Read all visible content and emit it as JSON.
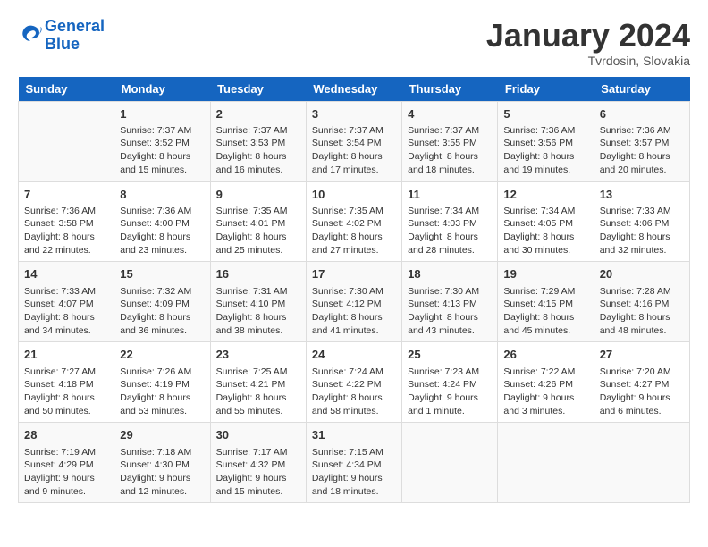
{
  "header": {
    "logo_line1": "General",
    "logo_line2": "Blue",
    "month_year": "January 2024",
    "location": "Tvrdosin, Slovakia"
  },
  "weekdays": [
    "Sunday",
    "Monday",
    "Tuesday",
    "Wednesday",
    "Thursday",
    "Friday",
    "Saturday"
  ],
  "weeks": [
    [
      {
        "num": "",
        "info": ""
      },
      {
        "num": "1",
        "info": "Sunrise: 7:37 AM\nSunset: 3:52 PM\nDaylight: 8 hours and 15 minutes."
      },
      {
        "num": "2",
        "info": "Sunrise: 7:37 AM\nSunset: 3:53 PM\nDaylight: 8 hours and 16 minutes."
      },
      {
        "num": "3",
        "info": "Sunrise: 7:37 AM\nSunset: 3:54 PM\nDaylight: 8 hours and 17 minutes."
      },
      {
        "num": "4",
        "info": "Sunrise: 7:37 AM\nSunset: 3:55 PM\nDaylight: 8 hours and 18 minutes."
      },
      {
        "num": "5",
        "info": "Sunrise: 7:36 AM\nSunset: 3:56 PM\nDaylight: 8 hours and 19 minutes."
      },
      {
        "num": "6",
        "info": "Sunrise: 7:36 AM\nSunset: 3:57 PM\nDaylight: 8 hours and 20 minutes."
      }
    ],
    [
      {
        "num": "7",
        "info": "Sunrise: 7:36 AM\nSunset: 3:58 PM\nDaylight: 8 hours and 22 minutes."
      },
      {
        "num": "8",
        "info": "Sunrise: 7:36 AM\nSunset: 4:00 PM\nDaylight: 8 hours and 23 minutes."
      },
      {
        "num": "9",
        "info": "Sunrise: 7:35 AM\nSunset: 4:01 PM\nDaylight: 8 hours and 25 minutes."
      },
      {
        "num": "10",
        "info": "Sunrise: 7:35 AM\nSunset: 4:02 PM\nDaylight: 8 hours and 27 minutes."
      },
      {
        "num": "11",
        "info": "Sunrise: 7:34 AM\nSunset: 4:03 PM\nDaylight: 8 hours and 28 minutes."
      },
      {
        "num": "12",
        "info": "Sunrise: 7:34 AM\nSunset: 4:05 PM\nDaylight: 8 hours and 30 minutes."
      },
      {
        "num": "13",
        "info": "Sunrise: 7:33 AM\nSunset: 4:06 PM\nDaylight: 8 hours and 32 minutes."
      }
    ],
    [
      {
        "num": "14",
        "info": "Sunrise: 7:33 AM\nSunset: 4:07 PM\nDaylight: 8 hours and 34 minutes."
      },
      {
        "num": "15",
        "info": "Sunrise: 7:32 AM\nSunset: 4:09 PM\nDaylight: 8 hours and 36 minutes."
      },
      {
        "num": "16",
        "info": "Sunrise: 7:31 AM\nSunset: 4:10 PM\nDaylight: 8 hours and 38 minutes."
      },
      {
        "num": "17",
        "info": "Sunrise: 7:30 AM\nSunset: 4:12 PM\nDaylight: 8 hours and 41 minutes."
      },
      {
        "num": "18",
        "info": "Sunrise: 7:30 AM\nSunset: 4:13 PM\nDaylight: 8 hours and 43 minutes."
      },
      {
        "num": "19",
        "info": "Sunrise: 7:29 AM\nSunset: 4:15 PM\nDaylight: 8 hours and 45 minutes."
      },
      {
        "num": "20",
        "info": "Sunrise: 7:28 AM\nSunset: 4:16 PM\nDaylight: 8 hours and 48 minutes."
      }
    ],
    [
      {
        "num": "21",
        "info": "Sunrise: 7:27 AM\nSunset: 4:18 PM\nDaylight: 8 hours and 50 minutes."
      },
      {
        "num": "22",
        "info": "Sunrise: 7:26 AM\nSunset: 4:19 PM\nDaylight: 8 hours and 53 minutes."
      },
      {
        "num": "23",
        "info": "Sunrise: 7:25 AM\nSunset: 4:21 PM\nDaylight: 8 hours and 55 minutes."
      },
      {
        "num": "24",
        "info": "Sunrise: 7:24 AM\nSunset: 4:22 PM\nDaylight: 8 hours and 58 minutes."
      },
      {
        "num": "25",
        "info": "Sunrise: 7:23 AM\nSunset: 4:24 PM\nDaylight: 9 hours and 1 minute."
      },
      {
        "num": "26",
        "info": "Sunrise: 7:22 AM\nSunset: 4:26 PM\nDaylight: 9 hours and 3 minutes."
      },
      {
        "num": "27",
        "info": "Sunrise: 7:20 AM\nSunset: 4:27 PM\nDaylight: 9 hours and 6 minutes."
      }
    ],
    [
      {
        "num": "28",
        "info": "Sunrise: 7:19 AM\nSunset: 4:29 PM\nDaylight: 9 hours and 9 minutes."
      },
      {
        "num": "29",
        "info": "Sunrise: 7:18 AM\nSunset: 4:30 PM\nDaylight: 9 hours and 12 minutes."
      },
      {
        "num": "30",
        "info": "Sunrise: 7:17 AM\nSunset: 4:32 PM\nDaylight: 9 hours and 15 minutes."
      },
      {
        "num": "31",
        "info": "Sunrise: 7:15 AM\nSunset: 4:34 PM\nDaylight: 9 hours and 18 minutes."
      },
      {
        "num": "",
        "info": ""
      },
      {
        "num": "",
        "info": ""
      },
      {
        "num": "",
        "info": ""
      }
    ]
  ]
}
